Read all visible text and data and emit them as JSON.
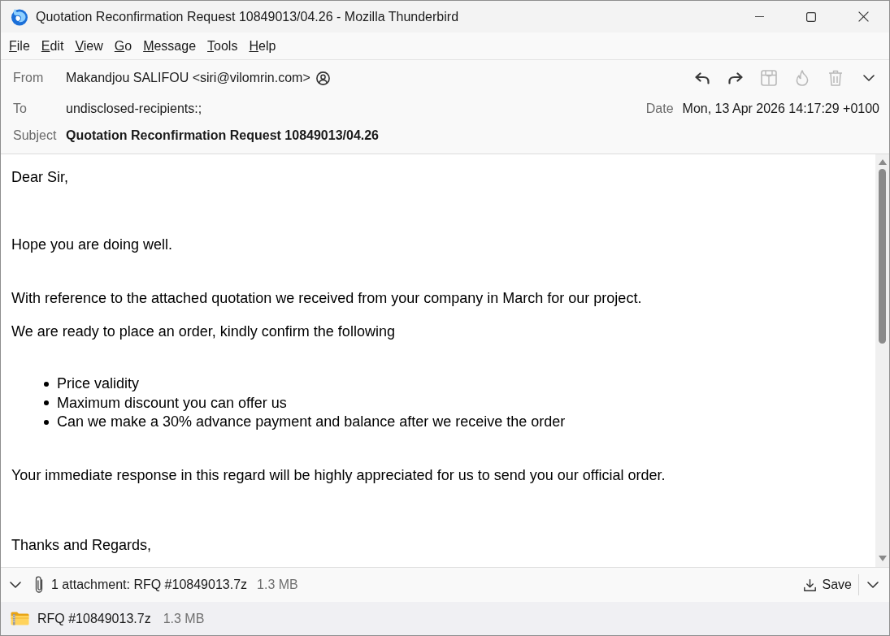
{
  "window": {
    "title": "Quotation Reconfirmation Request 10849013/04.26 - Mozilla Thunderbird"
  },
  "menu": [
    "File",
    "Edit",
    "View",
    "Go",
    "Message",
    "Tools",
    "Help"
  ],
  "header": {
    "toolbar": [
      {
        "disabled": false
      },
      {
        "disabled": false
      },
      {
        "disabled": true
      },
      {
        "disabled": true
      },
      {
        "disabled": true
      }
    ],
    "from": {
      "label": "From",
      "value": "Makandjou SALIFOU <siri@vilomrin.com>"
    },
    "to": {
      "label": "To",
      "value": "undisclosed-recipients:;"
    },
    "date": {
      "label": "Date",
      "value": "Mon, 13 Apr 2026 14:17:29 +0100"
    },
    "subject": {
      "label": "Subject",
      "value": "Quotation Reconfirmation Request 10849013/04.26"
    }
  },
  "body": [
    {
      "kind": "paragraph",
      "text": "Dear Sir,"
    },
    {
      "kind": "paragraph",
      "text": "Hope you are doing well."
    },
    {
      "kind": "paragraph",
      "text": "With reference to the attached quotation we received from your company in March for our project."
    },
    {
      "kind": "paragraph",
      "text": "We are ready to place an order, kindly confirm the following"
    },
    {
      "kind": "list",
      "items": [
        "Price validity",
        "Maximum discount you can offer us",
        "Can we make a 30% advance payment and balance after we receive the order"
      ]
    },
    {
      "kind": "paragraph",
      "text": "Your immediate response in this regard will be highly appreciated for us to send you our official order."
    },
    {
      "kind": "paragraph",
      "text": "Thanks and Regards,"
    }
  ],
  "attachment_bar": {
    "summary": "1 attachment: RFQ #10849013.7z",
    "size": "1.3 MB",
    "save": "Save"
  },
  "attachments": [
    {
      "name": "RFQ #10849013.7z",
      "size": "1.3 MB"
    }
  ]
}
